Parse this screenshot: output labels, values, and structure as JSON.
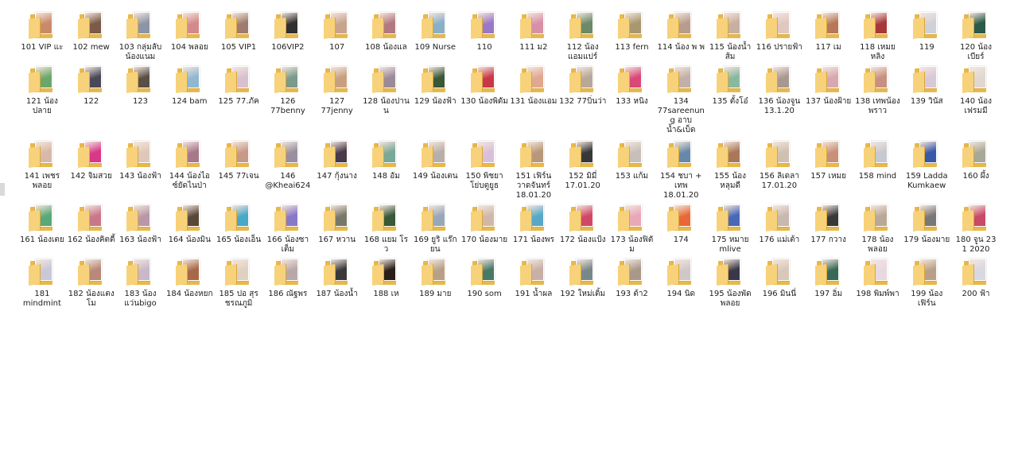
{
  "folders": [
    {
      "name": "101 VIP แะ",
      "thumb": "#c98a6a"
    },
    {
      "name": "102 mew",
      "thumb": "#7a5a48"
    },
    {
      "name": "103 กลุ่มลับ น้องแนม",
      "thumb": "#8c95a8"
    },
    {
      "name": "104 พลอย",
      "thumb": "#d48a8a"
    },
    {
      "name": "105 VIP1",
      "thumb": "#a07c70"
    },
    {
      "name": "106VIP2",
      "thumb": "#303030"
    },
    {
      "name": "107",
      "thumb": "#c8a48c"
    },
    {
      "name": "108 น้องแล",
      "thumb": "#b07a80"
    },
    {
      "name": "109 Nurse",
      "thumb": "#8ab0c8"
    },
    {
      "name": "110",
      "thumb": "#9a78c8"
    },
    {
      "name": "111 ม2",
      "thumb": "#d890a8"
    },
    {
      "name": "112 น้อง แอมแปร์",
      "thumb": "#6a8a6a"
    },
    {
      "name": "113 fern",
      "thumb": "#a89870"
    },
    {
      "name": "114 น้อง พ พ",
      "thumb": "#b89c8c"
    },
    {
      "name": "115 น้องน้ำ ส้ม",
      "thumb": "#c8b0a0"
    },
    {
      "name": "116 ปรายฟ้า",
      "thumb": "#e0c8c0"
    },
    {
      "name": "117 เม",
      "thumb": "#b87858"
    },
    {
      "name": "118 เหมย หลิง",
      "thumb": "#a83838"
    },
    {
      "name": "119",
      "thumb": "#d0d0d8"
    },
    {
      "name": "120 น้องเบียร์",
      "thumb": "#2a5a4a"
    },
    {
      "name": "121 น้อง ปลาย",
      "thumb": "#6aa86a"
    },
    {
      "name": "122",
      "thumb": "#484858"
    },
    {
      "name": "123",
      "thumb": "#585048"
    },
    {
      "name": "124 bam",
      "thumb": "#90b8d0"
    },
    {
      "name": "125 77.ภัค",
      "thumb": "#d8c0d0"
    },
    {
      "name": "126 77benny",
      "thumb": "#7a9a8a"
    },
    {
      "name": "127 77jenny",
      "thumb": "#c8a080"
    },
    {
      "name": "128 น้องปาน น",
      "thumb": "#9a8a9a"
    },
    {
      "name": "129 น้องฟ้า",
      "thumb": "#385838"
    },
    {
      "name": "130 น้องพิตัม",
      "thumb": "#c83848"
    },
    {
      "name": "131 น้องแอม",
      "thumb": "#e0a890"
    },
    {
      "name": "132 77บิ่นว่า",
      "thumb": "#b8a898"
    },
    {
      "name": "133 หนิง",
      "thumb": "#d84878"
    },
    {
      "name": "134 77sareenung อาบน้ำ&เบ็ด",
      "thumb": "#c0b0a8"
    },
    {
      "name": "135 ตั้งโอ๋",
      "thumb": "#88b8a0"
    },
    {
      "name": "136 น้องจูน 13.1.20",
      "thumb": "#a89890"
    },
    {
      "name": "137 น้องฝ้าย",
      "thumb": "#d8a8b0"
    },
    {
      "name": "138 เทพน้อง พราว",
      "thumb": "#c89080"
    },
    {
      "name": "139 วินัส",
      "thumb": "#d8c8d8"
    },
    {
      "name": "140 น้อง เฟรมมี",
      "thumb": "#e0d8d0"
    },
    {
      "name": "141 เพชร พลอย",
      "thumb": "#d8b8a8"
    },
    {
      "name": "142 จิมสวย",
      "thumb": "#d83888"
    },
    {
      "name": "143 น้องฟ้า",
      "thumb": "#e0c8b8"
    },
    {
      "name": "144 น้องไอ ซ์ยัดไนป่า",
      "thumb": "#a87888"
    },
    {
      "name": "145 77เจน",
      "thumb": "#c89888"
    },
    {
      "name": "146 @Kheai624",
      "thumb": "#9890a0"
    },
    {
      "name": "147 กุ้งนาง",
      "thumb": "#483848"
    },
    {
      "name": "148 อัม",
      "thumb": "#78a898"
    },
    {
      "name": "149 น้องเตน",
      "thumb": "#b8b0a8"
    },
    {
      "name": "150 พิชยา โย่บตูยูธ",
      "thumb": "#d8c0d8"
    },
    {
      "name": "151 เฟิร์น วาดจันทร์ 18.01.20",
      "thumb": "#b89878"
    },
    {
      "name": "152 มิมี่ 17.01.20",
      "thumb": "#383838"
    },
    {
      "name": "153 แก้ม",
      "thumb": "#c8c0b8"
    },
    {
      "name": "154 ชบา + เทพ 18.01.20",
      "thumb": "#6888a8"
    },
    {
      "name": "155 น้อง หลุมดี",
      "thumb": "#a87858"
    },
    {
      "name": "156 ลิเดลา 17.01.20",
      "thumb": "#d0c0b0"
    },
    {
      "name": "157 เหมย",
      "thumb": "#c89078"
    },
    {
      "name": "158 mind",
      "thumb": "#c8c8d0"
    },
    {
      "name": "159 Ladda Kumkaew",
      "thumb": "#3858a8"
    },
    {
      "name": "160 ผึ้ง",
      "thumb": "#a8a898"
    },
    {
      "name": "161 น้องเตย",
      "thumb": "#58a878"
    },
    {
      "name": "162 น้องคิตตี้",
      "thumb": "#c87888"
    },
    {
      "name": "163 น้องฟ้า",
      "thumb": "#b898a8"
    },
    {
      "name": "164 น้องมิน",
      "thumb": "#584838"
    },
    {
      "name": "165 น้องเอ็น",
      "thumb": "#48a8c8"
    },
    {
      "name": "166 น้องซา เต็ม",
      "thumb": "#8878c8"
    },
    {
      "name": "167 หวาน",
      "thumb": "#787868"
    },
    {
      "name": "168 แยม โร ว",
      "thumb": "#385838"
    },
    {
      "name": "169 ยูริ แร๊ก ยน",
      "thumb": "#98a8b8"
    },
    {
      "name": "170 น้องมาย",
      "thumb": "#d0b8a8"
    },
    {
      "name": "171 น้องพร",
      "thumb": "#58a8c8"
    },
    {
      "name": "172 น้องแป้ง",
      "thumb": "#d04868"
    },
    {
      "name": "173 น้องฟิตัม",
      "thumb": "#e8a8b8"
    },
    {
      "name": "174",
      "thumb": "#e86838"
    },
    {
      "name": "175 หมาย mlive",
      "thumb": "#4868b8"
    },
    {
      "name": "176 แม่เต้า",
      "thumb": "#c8b8b0"
    },
    {
      "name": "177 กวาง",
      "thumb": "#383838"
    },
    {
      "name": "178 น้อง พลอย",
      "thumb": "#b8a898"
    },
    {
      "name": "179 น้องมาย",
      "thumb": "#787878"
    },
    {
      "name": "180 จูน 23 1 2020",
      "thumb": "#c84868"
    },
    {
      "name": "181 mindmint",
      "thumb": "#c8c8d8"
    },
    {
      "name": "182 น้องแตง โม",
      "thumb": "#b88878"
    },
    {
      "name": "183 น้อง แว่นbigo",
      "thumb": "#c8b8c8"
    },
    {
      "name": "184 น้องหยก",
      "thumb": "#a86848"
    },
    {
      "name": "185 ปอ สุรชรณภูมิ",
      "thumb": "#e0d0c0"
    },
    {
      "name": "186 ณัฐพร",
      "thumb": "#b8a8a8"
    },
    {
      "name": "187 น้องน้ำ",
      "thumb": "#383838"
    },
    {
      "name": "188 เห",
      "thumb": "#282018"
    },
    {
      "name": "189 มาย",
      "thumb": "#b8a088"
    },
    {
      "name": "190 som",
      "thumb": "#487868"
    },
    {
      "name": "191 น้ำผล",
      "thumb": "#c8b0a8"
    },
    {
      "name": "192 ใหม่เติ้ม",
      "thumb": "#788888"
    },
    {
      "name": "193 ต้า2",
      "thumb": "#a89888"
    },
    {
      "name": "194 นิด",
      "thumb": "#d0c8c8"
    },
    {
      "name": "195 น้องพัด พลอย",
      "thumb": "#383848"
    },
    {
      "name": "196 มินนี่",
      "thumb": "#d8c8b8"
    },
    {
      "name": "197 อิ่ม",
      "thumb": "#386858"
    },
    {
      "name": "198 พิมพ์พา",
      "thumb": "#e8d8e0"
    },
    {
      "name": "199 น้อง เฟิร์น",
      "thumb": "#b8a088"
    },
    {
      "name": "200 ฟ้า",
      "thumb": "#d8d8e0"
    }
  ]
}
